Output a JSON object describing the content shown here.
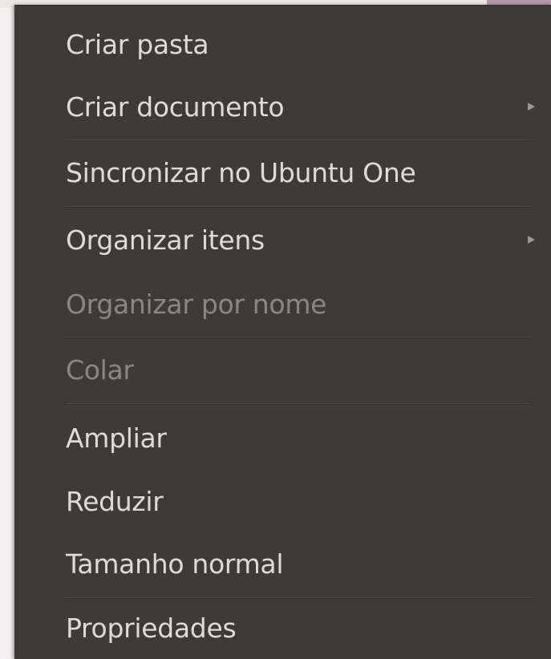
{
  "menu": {
    "items": [
      {
        "label": "Criar pasta",
        "disabled": false,
        "submenu": false
      },
      {
        "label": "Criar documento",
        "disabled": false,
        "submenu": true
      },
      {
        "label": "Sincronizar no Ubuntu One",
        "disabled": false,
        "submenu": false
      },
      {
        "label": "Organizar itens",
        "disabled": false,
        "submenu": true
      },
      {
        "label": "Organizar por nome",
        "disabled": true,
        "submenu": false
      },
      {
        "label": "Colar",
        "disabled": true,
        "submenu": false
      },
      {
        "label": "Ampliar",
        "disabled": false,
        "submenu": false
      },
      {
        "label": "Reduzir",
        "disabled": false,
        "submenu": false
      },
      {
        "label": "Tamanho normal",
        "disabled": false,
        "submenu": false
      },
      {
        "label": "Propriedades",
        "disabled": false,
        "submenu": false
      }
    ]
  },
  "colors": {
    "menu_background": "#3c3b37",
    "text": "#dfdbd2",
    "text_disabled": "#8a877f"
  }
}
